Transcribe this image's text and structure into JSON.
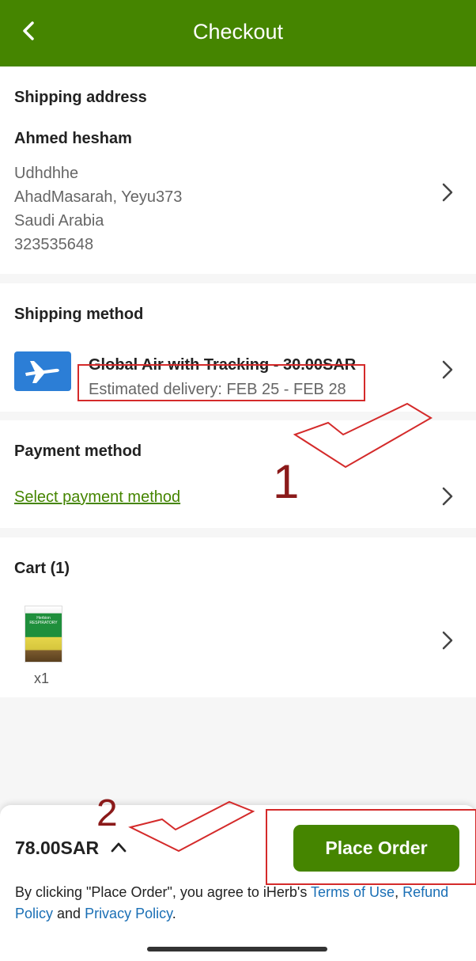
{
  "header": {
    "title": "Checkout"
  },
  "shipping_address": {
    "title": "Shipping address",
    "name": "Ahmed hesham",
    "lines": [
      "Udhdhhe",
      "AhadMasarah, Yeyu373",
      "Saudi Arabia",
      "323535648"
    ]
  },
  "shipping_method": {
    "title": "Shipping method",
    "name": "Global Air with Tracking - 30.00SAR",
    "estimated": "Estimated delivery: FEB 25 - FEB 28"
  },
  "payment_method": {
    "title": "Payment method",
    "link": "Select payment method"
  },
  "cart": {
    "title": "Cart (1)",
    "quantity": "x1",
    "product_image_text": "Herbion RESPIRATORY"
  },
  "footer": {
    "total": "78.00SAR",
    "place_order": "Place Order",
    "terms_prefix": "By clicking \"Place Order\", you agree to iHerb's ",
    "terms_link": "Terms of Use",
    "comma": ", ",
    "refund_link": "Refund Policy",
    "and": " and ",
    "privacy_link": "Privacy Policy",
    "period": "."
  },
  "annotations": {
    "label_1": "1",
    "label_2": "2"
  },
  "colors": {
    "brand_green": "#458500",
    "link_blue": "#1a6fb5",
    "annotation_red": "#d42a2a"
  }
}
